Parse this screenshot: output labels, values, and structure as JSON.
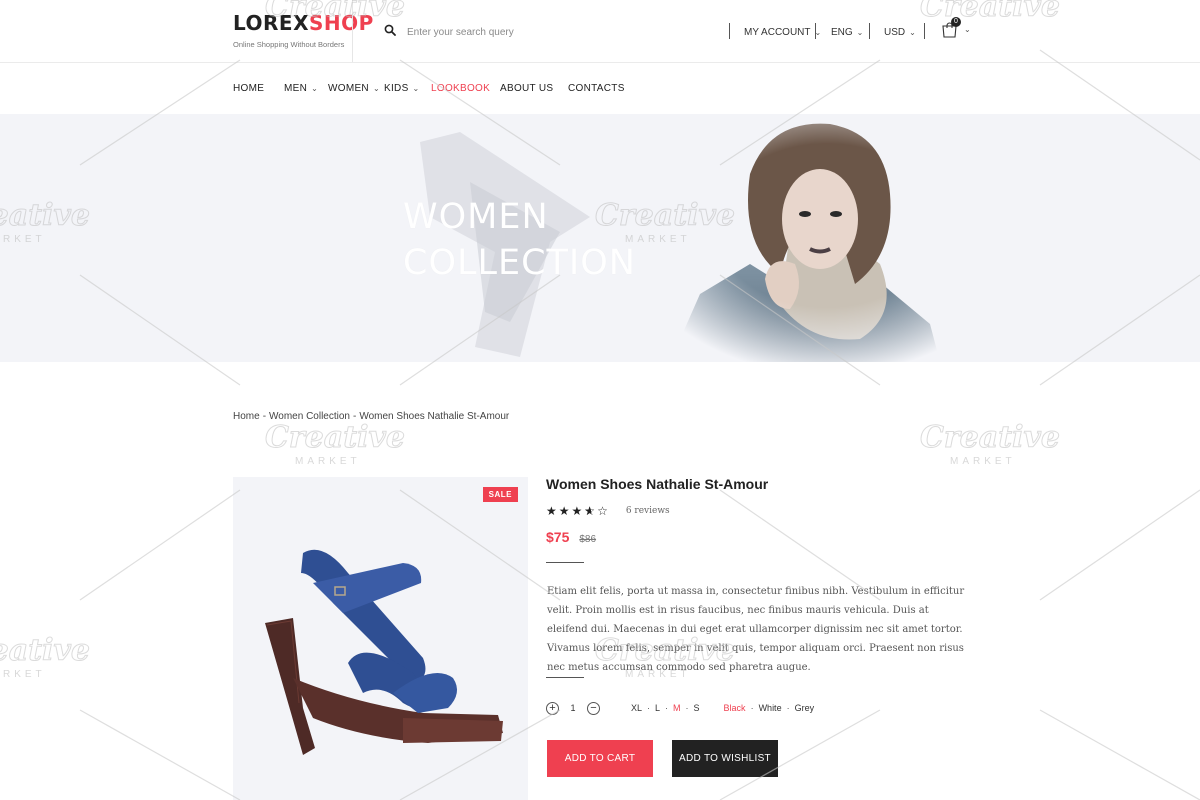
{
  "header": {
    "logo_part1": "LOREX",
    "logo_part2": "SHOP",
    "tagline": "Online Shopping Without Borders",
    "search_placeholder": "Enter your search query",
    "account_label": "MY ACCOUNT",
    "language_label": "ENG",
    "currency_label": "USD",
    "cart_count": "0"
  },
  "nav": {
    "items": [
      {
        "label": "HOME",
        "dropdown": false
      },
      {
        "label": "MEN",
        "dropdown": true
      },
      {
        "label": "WOMEN",
        "dropdown": true
      },
      {
        "label": "KIDS",
        "dropdown": true
      },
      {
        "label": "LOOKBOOK",
        "dropdown": false,
        "active": true
      },
      {
        "label": "ABOUT US",
        "dropdown": false
      },
      {
        "label": "CONTACTS",
        "dropdown": false
      }
    ]
  },
  "banner": {
    "title_line1": "WOMEN",
    "title_line2": "COLLECTION"
  },
  "breadcrumb": {
    "items": [
      "Home",
      "Women Collection",
      "Women Shoes Nathalie St-Amour"
    ],
    "separator": "-"
  },
  "product": {
    "sale_badge": "SALE",
    "title": "Women Shoes Nathalie St-Amour",
    "rating": 3.5,
    "rating_max": 5,
    "reviews_label": "6 reviews",
    "price": "$75",
    "old_price": "$86",
    "description": "Etiam elit felis, porta ut massa in, consectetur finibus nibh. Vestibulum in efficitur velit. Proin mollis est in risus faucibus, nec finibus mauris vehicula. Duis at eleifend dui. Maecenas in dui eget erat ullamcorper dignissim nec sit amet tortor. Vivamus lorem felis, semper in velit quis, tempor aliquam orci. Praesent non risus nec metus accumsan commodo sed pharetra augue.",
    "quantity": "1",
    "sizes": [
      "XL",
      "L",
      "M",
      "S"
    ],
    "selected_size": "M",
    "colors": [
      "Black",
      "White",
      "Grey"
    ],
    "selected_color": "Black",
    "add_to_cart_label": "ADD TO CART",
    "add_to_wishlist_label": "ADD TO WISHLIST"
  },
  "watermark": {
    "text": "Creative",
    "sub": "MARKET"
  },
  "colors": {
    "accent": "#ef4050",
    "dark": "#222222",
    "banner_bg": "#f3f4f8"
  }
}
